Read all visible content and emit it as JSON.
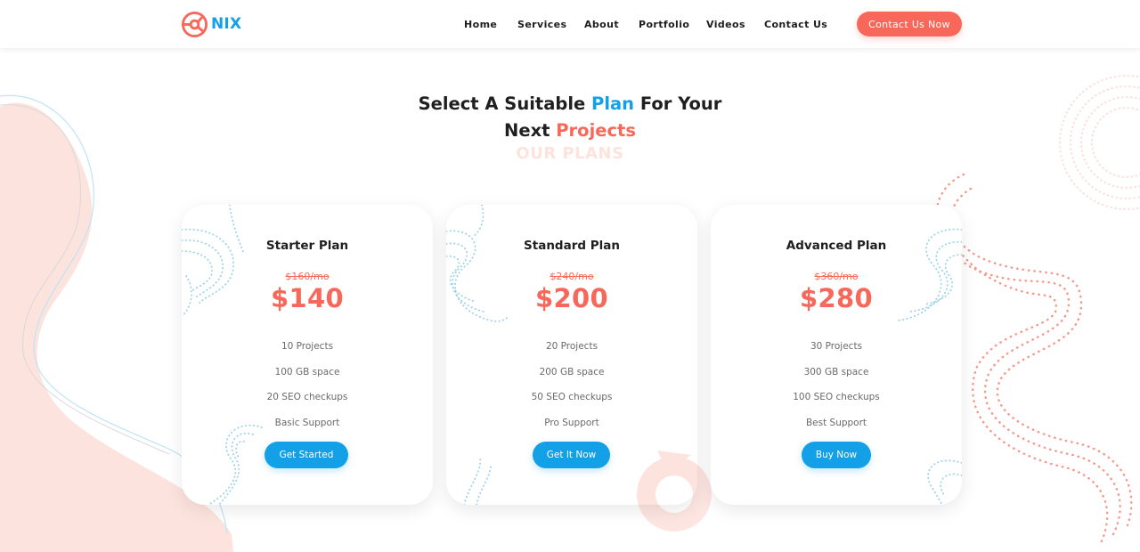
{
  "brand": {
    "name": "NIX",
    "logo_icon": "crosshair-logo-icon"
  },
  "nav": {
    "items": [
      {
        "label": "Home"
      },
      {
        "label": "Services"
      },
      {
        "label": "About"
      },
      {
        "label": "Portfolio"
      },
      {
        "label": "Videos"
      },
      {
        "label": "Contact Us"
      }
    ],
    "cta_label": "Contact Us Now"
  },
  "pricing": {
    "heading": {
      "part1": "Select A Suitable ",
      "accent1": "Plan",
      "part2": " For Your",
      "part3": "Next ",
      "accent2": "Projects"
    },
    "ghost_label": "OUR PLANS",
    "plans": [
      {
        "name": "Starter Plan",
        "old_price": "$160/mo",
        "price": "$140",
        "features": [
          "10 Projects",
          "100 GB space",
          "20 SEO checkups",
          "Basic Support"
        ],
        "button": "Get Started"
      },
      {
        "name": "Standard Plan",
        "old_price": "$240/mo",
        "price": "$200",
        "features": [
          "20 Projects",
          "200 GB space",
          "50 SEO checkups",
          "Pro Support"
        ],
        "button": "Get It Now"
      },
      {
        "name": "Advanced Plan",
        "old_price": "$360/mo",
        "price": "$280",
        "features": [
          "30 Projects",
          "300 GB space",
          "100 SEO checkups",
          "Best Support"
        ],
        "button": "Buy Now"
      }
    ]
  },
  "colors": {
    "accent_blue": "#14a0e6",
    "accent_coral": "#f7685a",
    "blob_pink": "#fde3de"
  }
}
